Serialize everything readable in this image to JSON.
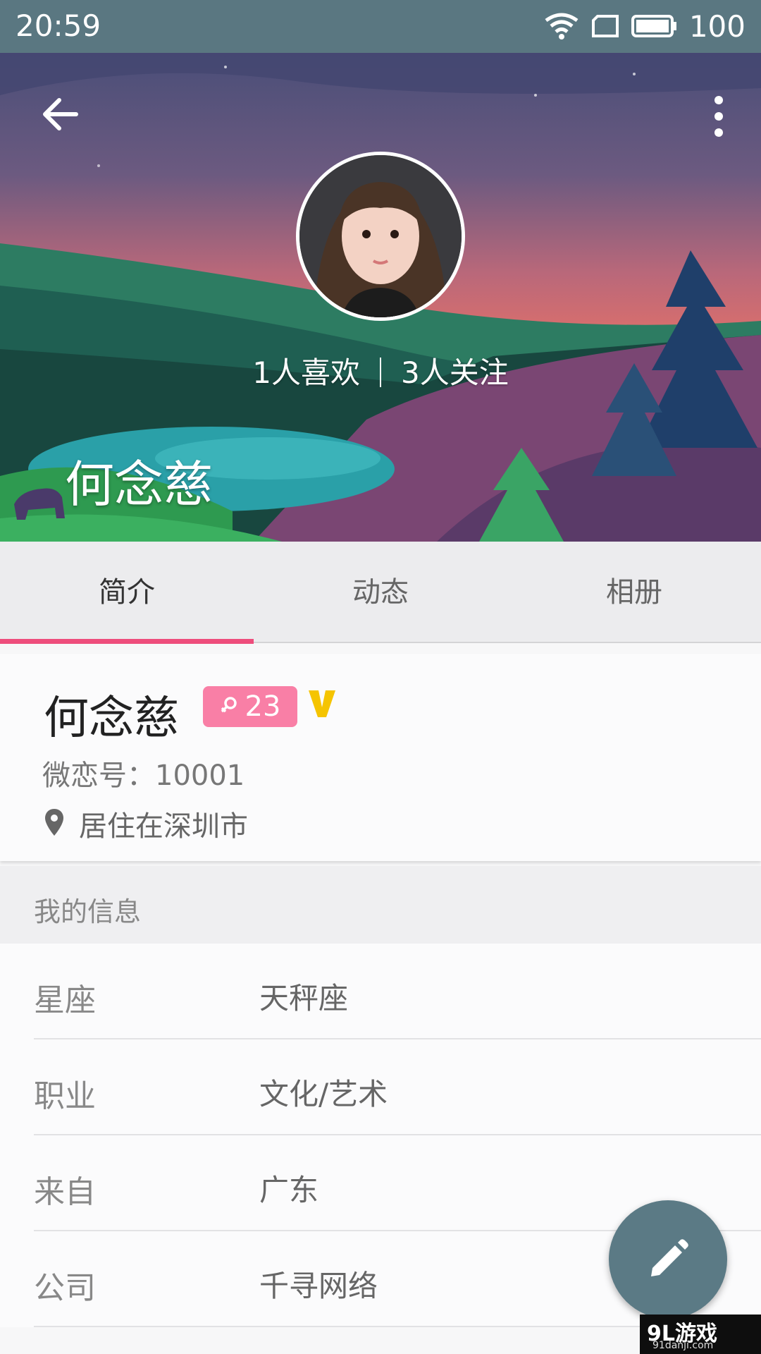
{
  "status_bar": {
    "time": "20:59",
    "battery": "100"
  },
  "header": {
    "stats": {
      "likes": "1人喜欢",
      "follows": "3人关注"
    },
    "name": "何念慈"
  },
  "tabs": [
    {
      "label": "简介",
      "active": true
    },
    {
      "label": "动态",
      "active": false
    },
    {
      "label": "相册",
      "active": false
    }
  ],
  "profile": {
    "name": "何念慈",
    "age": "23",
    "vip": "V",
    "user_id": "微恋号：10001",
    "location": "居住在深圳市"
  },
  "info": {
    "section_title": "我的信息",
    "rows": [
      {
        "label": "星座",
        "value": "天秤座"
      },
      {
        "label": "职业",
        "value": "文化/艺术"
      },
      {
        "label": "来自",
        "value": "广东"
      },
      {
        "label": "公司",
        "value": "千寻网络"
      }
    ]
  },
  "watermark": {
    "main": "9L游戏",
    "sub": "91danji.com"
  },
  "colors": {
    "accent": "#ee4d7c",
    "status_bar": "#5a7781",
    "fab": "#5b7a85",
    "badge": "#f97fa6",
    "vip": "#f5c400"
  }
}
